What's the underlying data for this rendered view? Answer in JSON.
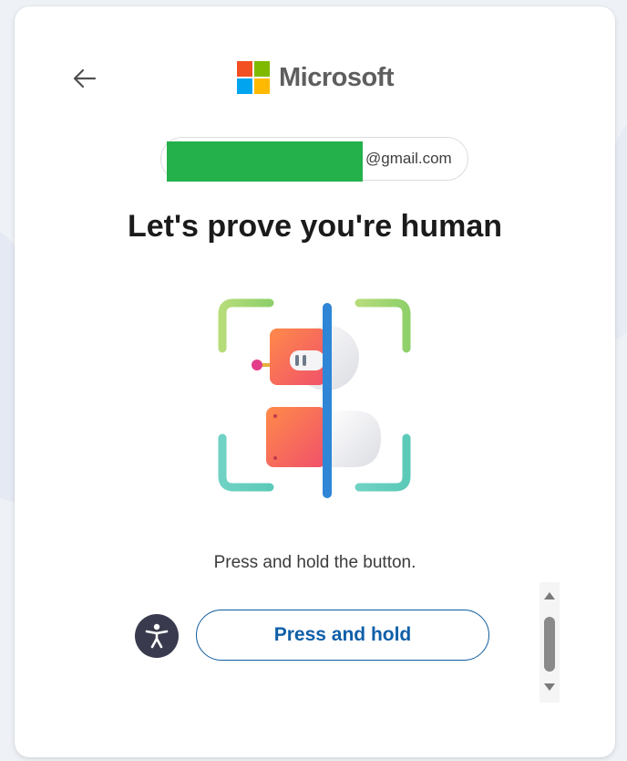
{
  "brand": {
    "name": "Microsoft",
    "logo_colors": [
      "#f25022",
      "#7fba00",
      "#00a4ef",
      "#ffb900"
    ]
  },
  "account": {
    "email_domain": "@gmail.com",
    "redaction_color": "#24b14c"
  },
  "page": {
    "title": "Let's prove you're human",
    "instruction": "Press and hold the button."
  },
  "actions": {
    "hold_label": "Press and hold"
  },
  "icons": {
    "back": "back-arrow-icon",
    "accessibility": "accessibility-icon",
    "scroll_up": "scroll-up-arrow-icon",
    "scroll_down": "scroll-down-arrow-icon"
  },
  "colors": {
    "primary_text": "#0f5fa8",
    "button_border": "#0e5c9e",
    "a11y_bg": "#3a3a4e"
  }
}
